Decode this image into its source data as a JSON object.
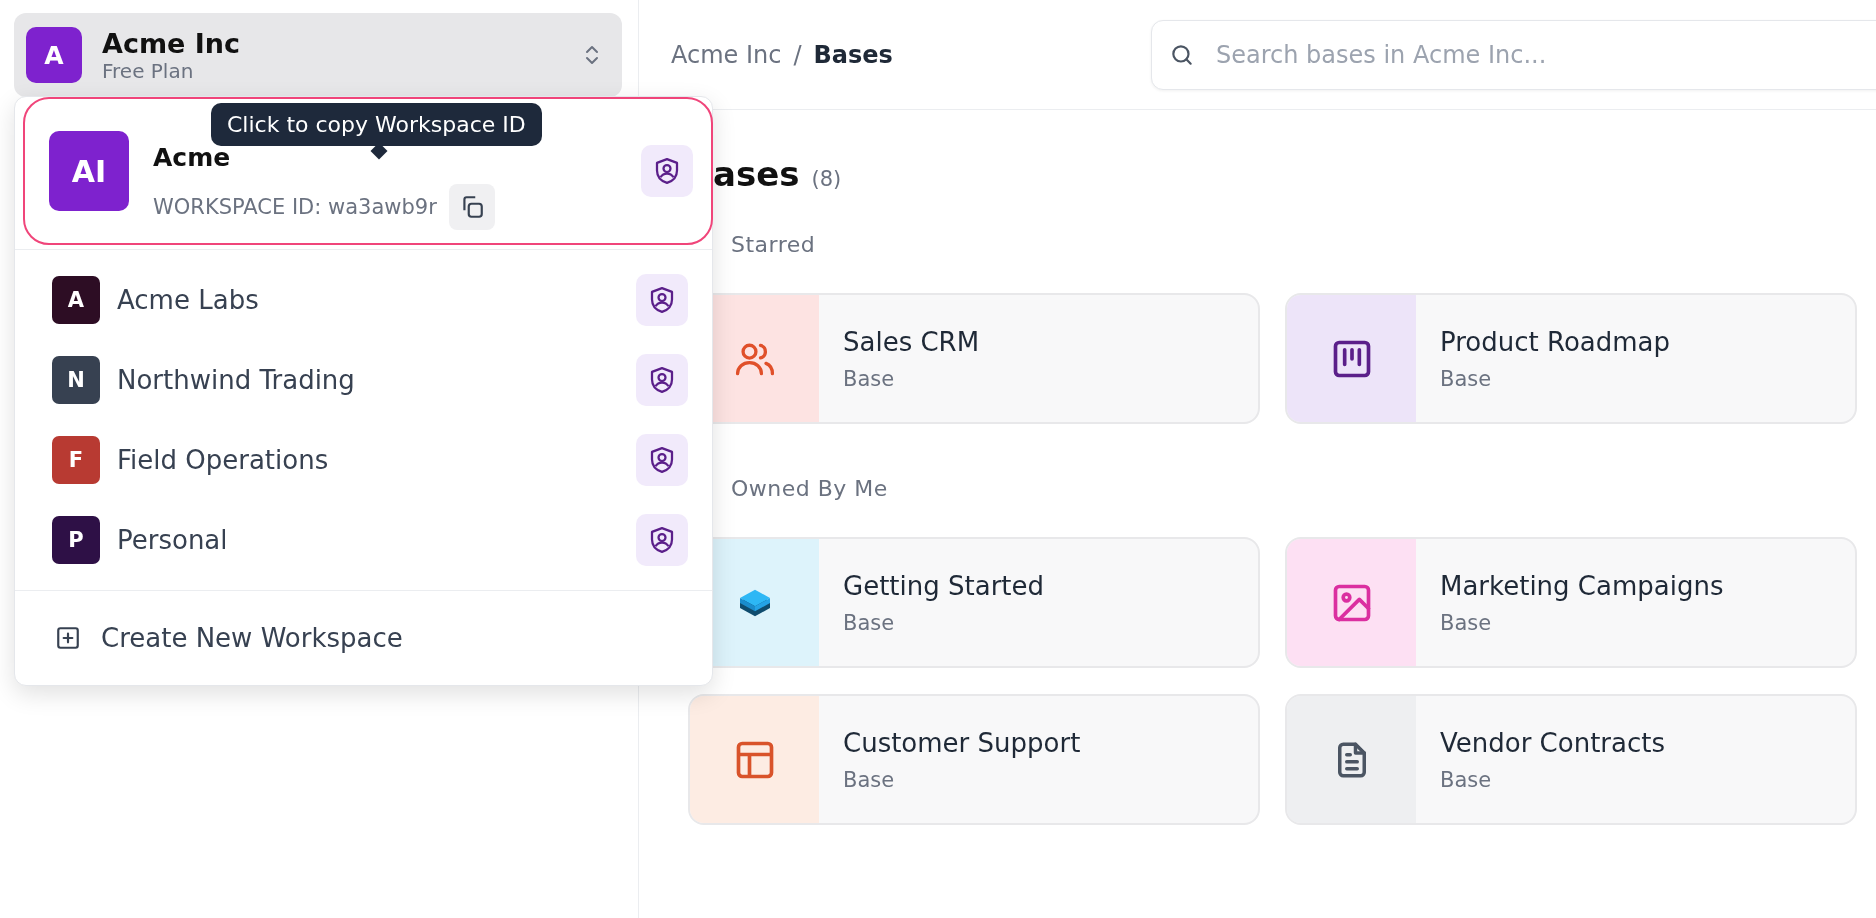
{
  "workspace_switcher": {
    "initial": "A",
    "name": "Acme Inc",
    "plan": "Free Plan"
  },
  "workspace_menu": {
    "current": {
      "initials": "AI",
      "name": "Acme",
      "workspace_id": "WORKSPACE ID: wa3awb9r",
      "tooltip": "Click to copy Workspace ID"
    },
    "workspaces": [
      {
        "initial": "A",
        "name": "Acme Labs",
        "color": "#2d0d24"
      },
      {
        "initial": "N",
        "name": "Northwind Trading",
        "color": "#374151"
      },
      {
        "initial": "F",
        "name": "Field Operations",
        "color": "#b83a32"
      },
      {
        "initial": "P",
        "name": "Personal",
        "color": "#2e1046"
      }
    ],
    "create_label": "Create New Workspace"
  },
  "breadcrumb": {
    "parent": "Acme Inc",
    "separator": "/",
    "current": "Bases"
  },
  "search": {
    "placeholder": "Search bases in Acme Inc..."
  },
  "heading": {
    "title": "ases",
    "count": "(8)"
  },
  "sections": [
    {
      "label": "Starred",
      "bases": [
        {
          "name": "Sales CRM",
          "type": "Base",
          "kind": "people",
          "color": "#fde3e2"
        },
        {
          "name": "Product Roadmap",
          "type": "Base",
          "kind": "kanban",
          "color": "#ede4f9"
        }
      ]
    },
    {
      "label": "Owned By Me",
      "bases": [
        {
          "name": "Getting Started",
          "type": "Base",
          "kind": "cube",
          "color": "#ddf3fb"
        },
        {
          "name": "Marketing Campaigns",
          "type": "Base",
          "kind": "image",
          "color": "#fde0f3"
        },
        {
          "name": "Customer Support",
          "type": "Base",
          "kind": "layout",
          "color": "#fdece3"
        },
        {
          "name": "Vendor Contracts",
          "type": "Base",
          "kind": "document",
          "color": "#eeeff1"
        }
      ]
    }
  ]
}
